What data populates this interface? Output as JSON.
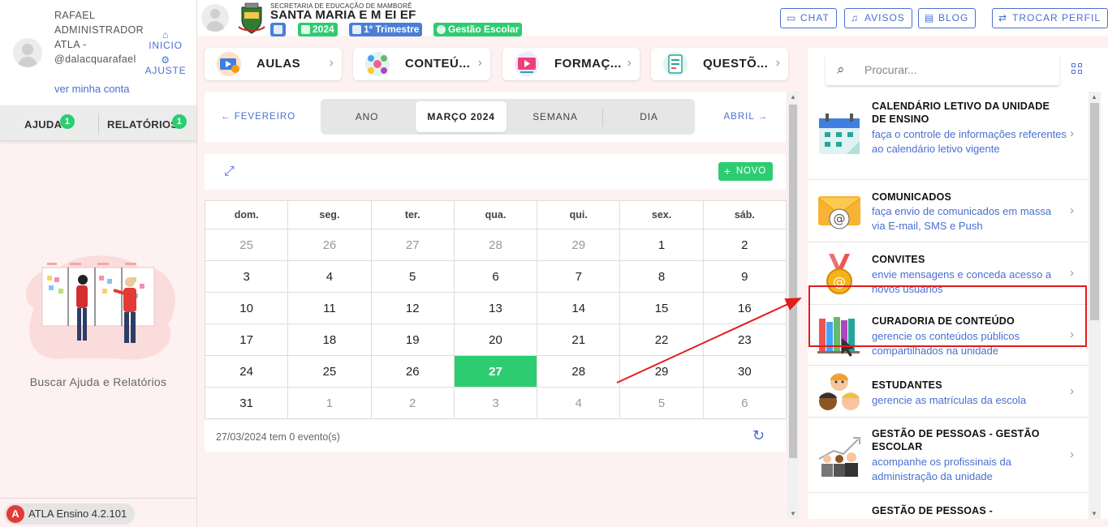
{
  "sidebar": {
    "user_name": "RAFAEL ADMINISTRADOR ATLA - @dalacquarafael",
    "account_link": "ver minha conta",
    "home_label": "INICIO",
    "settings_label": "AJUSTE",
    "tabs": [
      {
        "label": "AJUDA",
        "badge": "1"
      },
      {
        "label": "RELATÓRIOS",
        "badge": "1"
      }
    ],
    "help_caption": "Buscar Ajuda e Relatórios",
    "version": "ATLA Ensino 4.2.101",
    "version_logo": "A"
  },
  "header": {
    "secretaria": "SECRETARIA DE EDUCAÇÃO DE MAMBORÊ",
    "school": "SANTA MARIA E M EI EF",
    "year": "2024",
    "term": "1º Trimestre",
    "mode": "Gestão Escolar",
    "buttons": {
      "chat": "CHAT",
      "avisos": "AVISOS",
      "blog": "BLOG",
      "perfil": "TROCAR PERFIL"
    }
  },
  "modules": [
    {
      "label": "AULAS"
    },
    {
      "label": "CONTEÚ..."
    },
    {
      "label": "FORMAÇ..."
    },
    {
      "label": "QUESTÕ..."
    }
  ],
  "calendar": {
    "prev": "FEVEREIRO",
    "next": "ABRIL",
    "views": [
      "ANO",
      "MARÇO 2024",
      "SEMANA",
      "DIA"
    ],
    "active_view": "MARÇO 2024",
    "new_label": "NOVO",
    "weekdays": [
      "dom.",
      "seg.",
      "ter.",
      "qua.",
      "qui.",
      "sex.",
      "sáb."
    ],
    "weeks": [
      [
        "25",
        "26",
        "27",
        "28",
        "29",
        "1",
        "2"
      ],
      [
        "3",
        "4",
        "5",
        "6",
        "7",
        "8",
        "9"
      ],
      [
        "10",
        "11",
        "12",
        "13",
        "14",
        "15",
        "16"
      ],
      [
        "17",
        "18",
        "19",
        "20",
        "21",
        "22",
        "23"
      ],
      [
        "24",
        "25",
        "26",
        "27",
        "28",
        "29",
        "30"
      ],
      [
        "31",
        "1",
        "2",
        "3",
        "4",
        "5",
        "6"
      ]
    ],
    "today": "27",
    "footer": "27/03/2024 tem 0 evento(s)"
  },
  "right_panel": {
    "search_placeholder": "Procurar...",
    "items": [
      {
        "title": "CALENDÁRIO LETIVO DA UNIDADE DE ENSINO",
        "desc": "faça o controle de informações referentes ao calendário letivo vigente",
        "icon": "calendar-icon"
      },
      {
        "title": "COMUNICADOS",
        "desc": "faça envio de comunicados em massa via E-mail, SMS e Push",
        "icon": "envelope-icon"
      },
      {
        "title": "CONVITES",
        "desc": "envie mensagens e conceda acesso a novos usuários",
        "icon": "medal-icon"
      },
      {
        "title": "CURADORIA DE CONTEÚDO",
        "desc": "gerencie os conteúdos públicos compartilhados na unidade",
        "icon": "books-icon"
      },
      {
        "title": "ESTUDANTES",
        "desc": "gerencie as matrículas da escola",
        "icon": "students-icon"
      },
      {
        "title": "GESTÃO DE PESSOAS - GESTÃO ESCOLAR",
        "desc": "acompanhe os profissinais da administração da unidade",
        "icon": "people-growth-icon"
      },
      {
        "title": "GESTÃO DE PESSOAS -",
        "desc": "",
        "icon": "people-icon"
      }
    ]
  },
  "colors": {
    "accent": "#4a6fd1",
    "green": "#2ecc71",
    "highlight": "#e31b1b",
    "background": "#fdf1f1"
  }
}
